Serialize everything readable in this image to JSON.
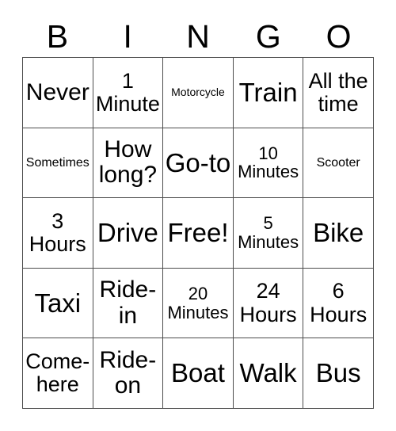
{
  "card": {
    "title_letters": [
      "B",
      "I",
      "N",
      "G",
      "O"
    ],
    "columns": 5,
    "rows": 5,
    "border_color": "#4d4d4d",
    "background_color": "#ffffff",
    "text_color": "#000000",
    "free_space_label": "Free!",
    "free_space_position": "row3-col3",
    "cells": [
      [
        {
          "text": "Never",
          "size": "lg"
        },
        {
          "text": "1 Minute",
          "size": "md"
        },
        {
          "text": "Motorcycle",
          "size": "xxs"
        },
        {
          "text": "Train",
          "size": "xl"
        },
        {
          "text": "All the time",
          "size": "md"
        }
      ],
      [
        {
          "text": "Sometimes",
          "size": "xs"
        },
        {
          "text": "How long?",
          "size": "lg"
        },
        {
          "text": "Go-to",
          "size": "xl"
        },
        {
          "text": "10 Minutes",
          "size": "sm"
        },
        {
          "text": "Scooter",
          "size": "xs"
        }
      ],
      [
        {
          "text": "3 Hours",
          "size": "md"
        },
        {
          "text": "Drive",
          "size": "xl"
        },
        {
          "text": "Free!",
          "size": "xl"
        },
        {
          "text": "5 Minutes",
          "size": "sm"
        },
        {
          "text": "Bike",
          "size": "xl"
        }
      ],
      [
        {
          "text": "Taxi",
          "size": "xl"
        },
        {
          "text": "Ride-in",
          "size": "lg"
        },
        {
          "text": "20 Minutes",
          "size": "sm"
        },
        {
          "text": "24 Hours",
          "size": "md"
        },
        {
          "text": "6 Hours",
          "size": "md"
        }
      ],
      [
        {
          "text": "Come-here",
          "size": "md"
        },
        {
          "text": "Ride-on",
          "size": "lg"
        },
        {
          "text": "Boat",
          "size": "xl"
        },
        {
          "text": "Walk",
          "size": "xl"
        },
        {
          "text": "Bus",
          "size": "xl"
        }
      ]
    ]
  }
}
